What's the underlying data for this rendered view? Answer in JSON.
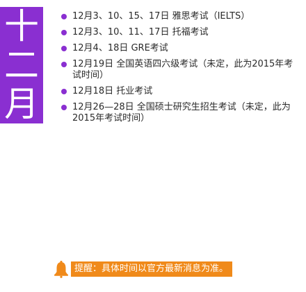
{
  "month": {
    "line1": "十",
    "line2": "二",
    "line3": "月"
  },
  "events": [
    {
      "text": "12月3、10、15、17日 雅思考试（IELTS）"
    },
    {
      "text": "12月3、10、11、17日 托福考试"
    },
    {
      "text": "12月4、18日 GRE考试"
    },
    {
      "text": "12月19日 全国英语四六级考试（未定，此为2015年考试时间）"
    },
    {
      "text": "12月18日 托业考试"
    },
    {
      "text": "12月26—28日 全国硕士研究生招生考试（未定，此为2015年考试时间）"
    }
  ],
  "notice": {
    "icon": "bell-icon",
    "text": "提醒：具体时间以官方最新消息为准。"
  },
  "colors": {
    "accent_purple": "#8a2fd1",
    "notice_orange": "#f08a1a"
  }
}
